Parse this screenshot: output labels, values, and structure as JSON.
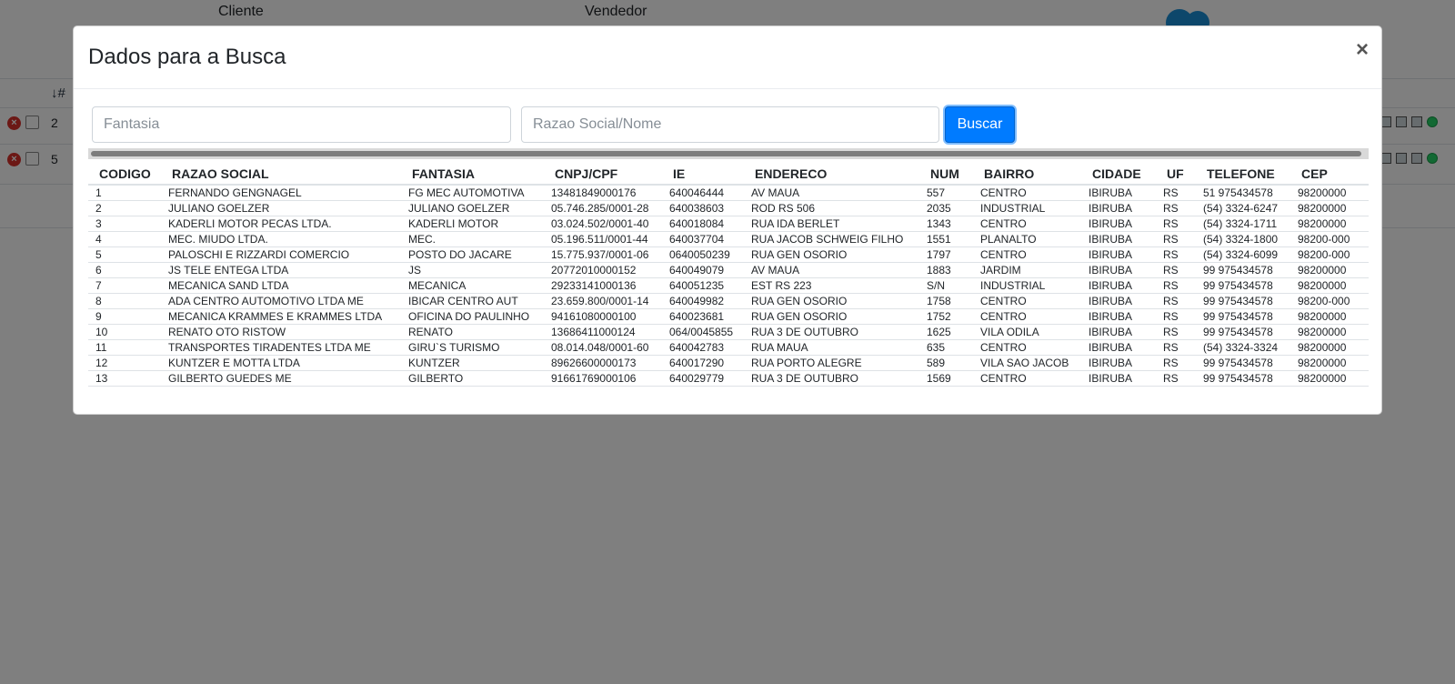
{
  "background": {
    "header_labels": [
      "Cliente",
      "Vendedor"
    ],
    "sort_label": "#",
    "rows": [
      "2",
      "5"
    ]
  },
  "modal": {
    "title": "Dados para a Busca",
    "close_label": "×",
    "search": {
      "fantasia_placeholder": "Fantasia",
      "fantasia_value": "",
      "razao_placeholder": "Razao Social/Nome",
      "razao_value": "",
      "button_label": "Buscar"
    },
    "table": {
      "columns": [
        "CODIGO",
        "RAZAO SOCIAL",
        "FANTASIA",
        "CNPJ/CPF",
        "IE",
        "ENDERECO",
        "NUM",
        "BAIRRO",
        "CIDADE",
        "UF",
        "TELEFONE",
        "CEP"
      ],
      "rows": [
        [
          "1",
          "FERNANDO GENGNAGEL",
          "FG MEC AUTOMOTIVA",
          "13481849000176",
          "640046444",
          "AV MAUA",
          "557",
          "CENTRO",
          "IBIRUBA",
          "RS",
          "51 975434578",
          "98200000"
        ],
        [
          "2",
          "JULIANO GOELZER",
          "JULIANO GOELZER",
          "05.746.285/0001-28",
          "640038603",
          "ROD RS 506",
          "2035",
          "INDUSTRIAL",
          "IBIRUBA",
          "RS",
          "(54) 3324-6247",
          "98200000"
        ],
        [
          "3",
          "KADERLI MOTOR PECAS LTDA.",
          "KADERLI MOTOR",
          "03.024.502/0001-40",
          "640018084",
          "RUA IDA BERLET",
          "1343",
          "CENTRO",
          "IBIRUBA",
          "RS",
          "(54) 3324-1711",
          "98200000"
        ],
        [
          "4",
          "MEC. MIUDO LTDA.",
          "MEC.",
          "05.196.511/0001-44",
          "640037704",
          "RUA JACOB SCHWEIG FILHO",
          "1551",
          "PLANALTO",
          "IBIRUBA",
          "RS",
          "(54) 3324-1800",
          "98200-000"
        ],
        [
          "5",
          "PALOSCHI E RIZZARDI COMERCIO",
          "POSTO DO JACARE",
          "15.775.937/0001-06",
          "0640050239",
          "RUA GEN OSORIO",
          "1797",
          "CENTRO",
          "IBIRUBA",
          "RS",
          "(54) 3324-6099",
          "98200-000"
        ],
        [
          "6",
          "JS TELE ENTEGA LTDA",
          "JS",
          "20772010000152",
          "640049079",
          "AV MAUA",
          "1883",
          "JARDIM",
          "IBIRUBA",
          "RS",
          "99 975434578",
          "98200000"
        ],
        [
          "7",
          "MECANICA SAND LTDA",
          "MECANICA",
          "29233141000136",
          "640051235",
          "EST RS 223",
          "S/N",
          "INDUSTRIAL",
          "IBIRUBA",
          "RS",
          "99 975434578",
          "98200000"
        ],
        [
          "8",
          "ADA CENTRO AUTOMOTIVO LTDA ME",
          "IBICAR CENTRO AUT",
          "23.659.800/0001-14",
          "640049982",
          "RUA GEN OSORIO",
          "1758",
          "CENTRO",
          "IBIRUBA",
          "RS",
          "99 975434578",
          "98200-000"
        ],
        [
          "9",
          "MECANICA KRAMMES E KRAMMES LTDA",
          "OFICINA DO PAULINHO",
          "94161080000100",
          "640023681",
          "RUA GEN OSORIO",
          "1752",
          "CENTRO",
          "IBIRUBA",
          "RS",
          "99 975434578",
          "98200000"
        ],
        [
          "10",
          "RENATO OTO RISTOW",
          "RENATO",
          "13686411000124",
          "064/0045855",
          "RUA 3 DE OUTUBRO",
          "1625",
          "VILA ODILA",
          "IBIRUBA",
          "RS",
          "99 975434578",
          "98200000"
        ],
        [
          "11",
          "TRANSPORTES TIRADENTES LTDA ME",
          "GIRU`S TURISMO",
          "08.014.048/0001-60",
          "640042783",
          "RUA MAUA",
          "635",
          "CENTRO",
          "IBIRUBA",
          "RS",
          "(54) 3324-3324",
          "98200000"
        ],
        [
          "12",
          "KUNTZER E MOTTA LTDA",
          "KUNTZER",
          "89626600000173",
          "640017290",
          "RUA PORTO ALEGRE",
          "589",
          "VILA SAO JACOB",
          "IBIRUBA",
          "RS",
          "99 975434578",
          "98200000"
        ],
        [
          "13",
          "GILBERTO GUEDES ME",
          "GILBERTO",
          "91661769000106",
          "640029779",
          "RUA 3 DE OUTUBRO",
          "1569",
          "CENTRO",
          "IBIRUBA",
          "RS",
          "99 975434578",
          "98200000"
        ]
      ]
    }
  }
}
